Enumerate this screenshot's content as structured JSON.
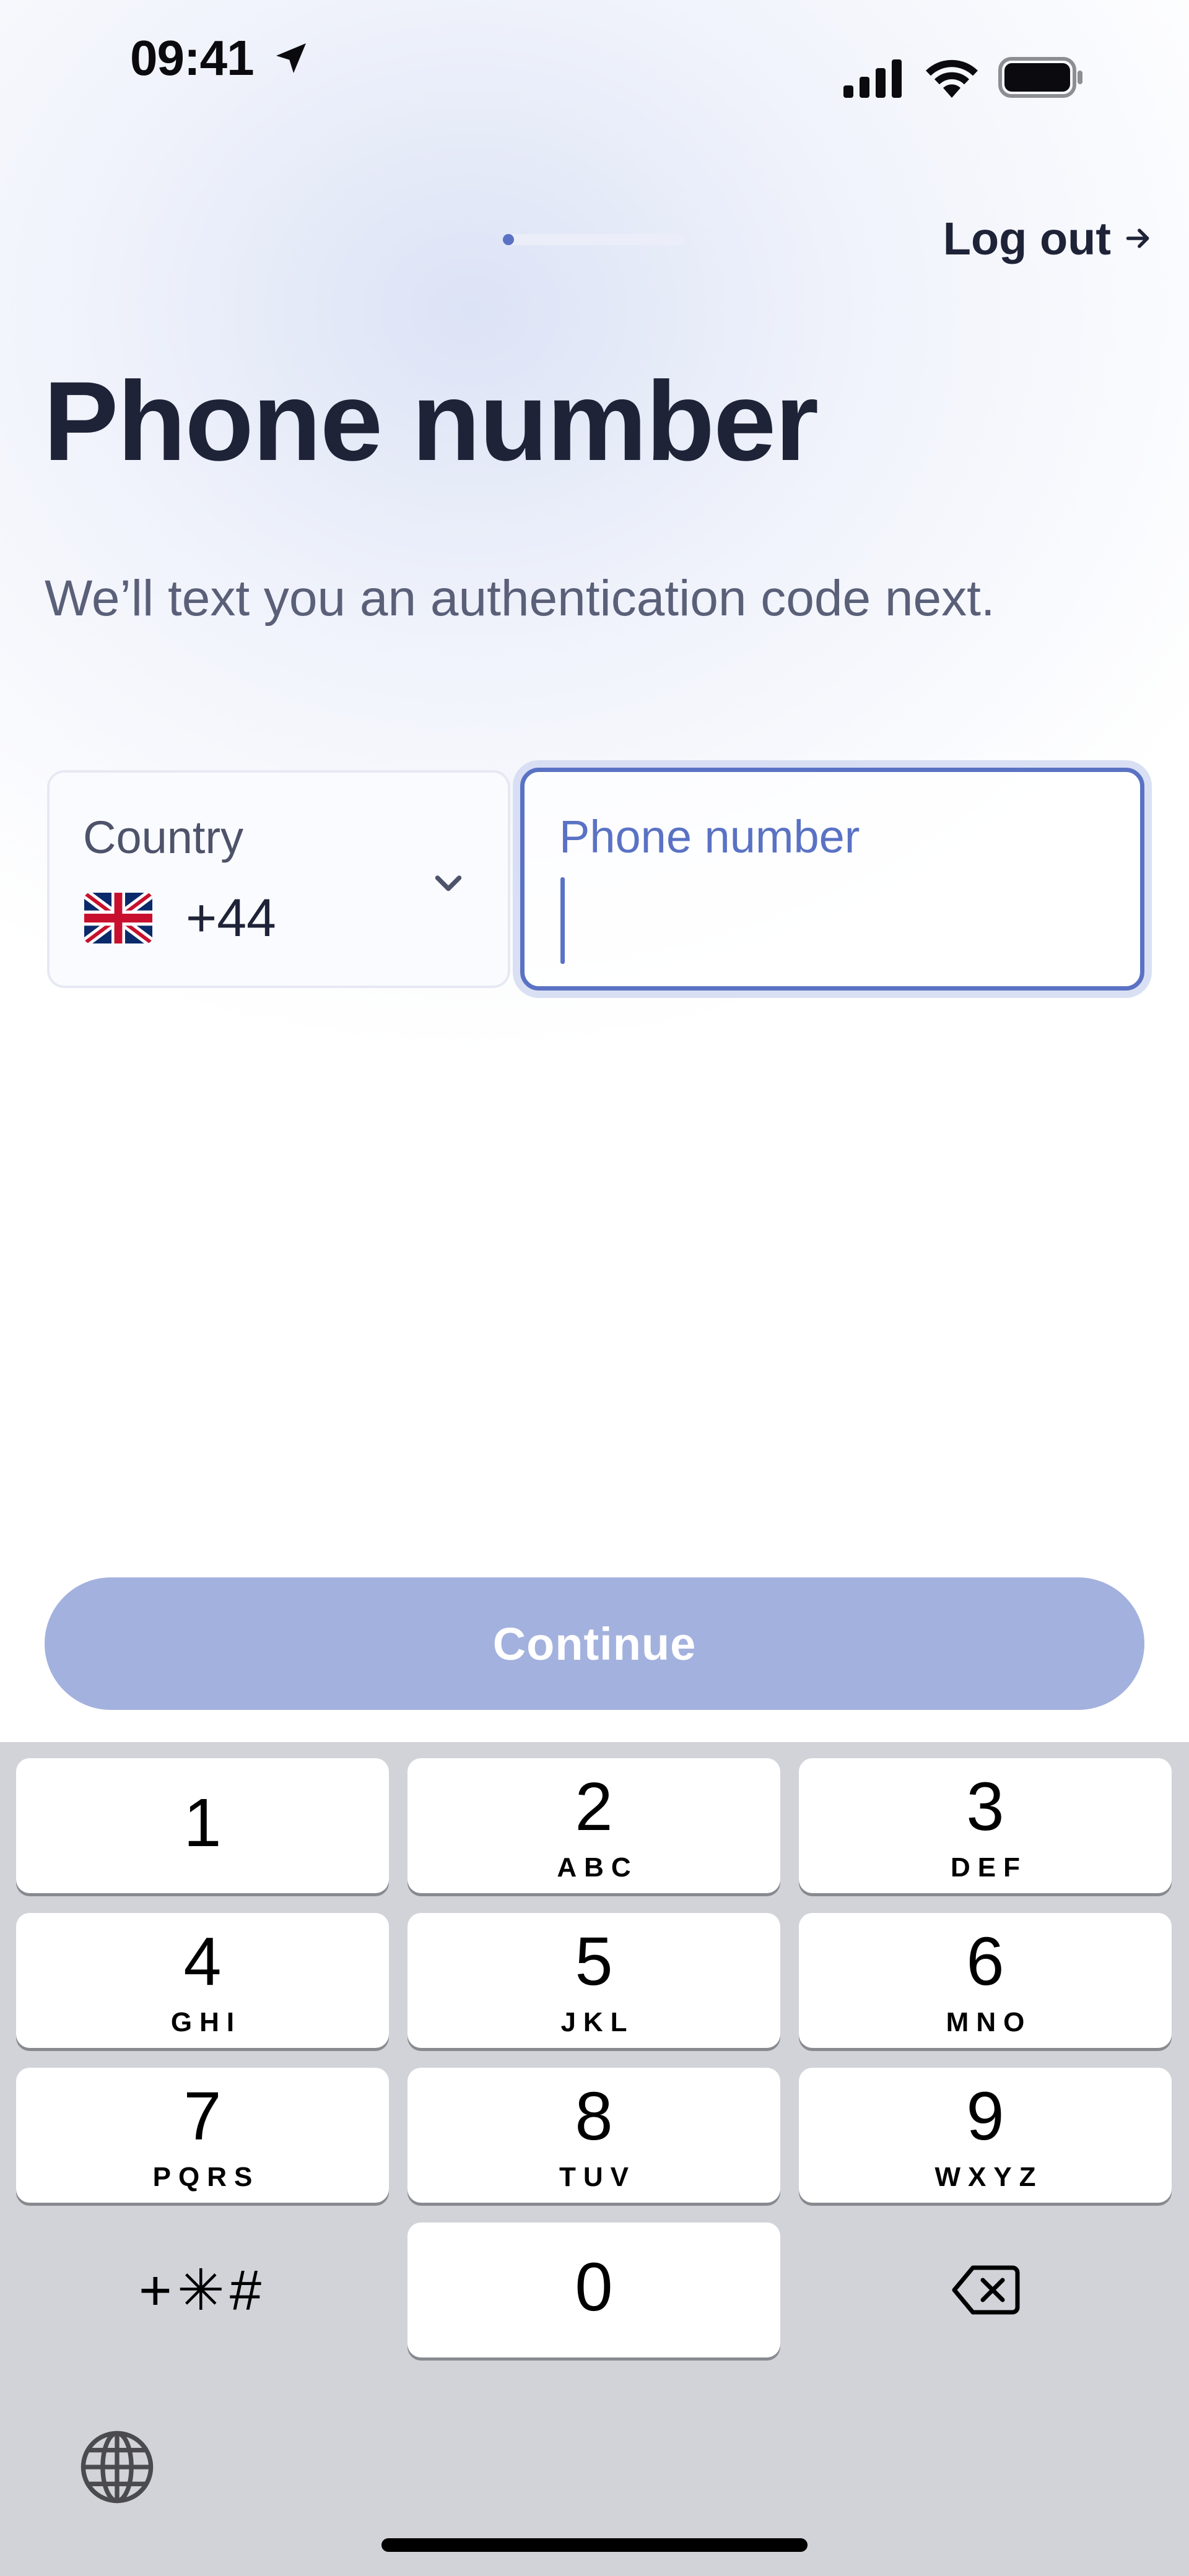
{
  "status_bar": {
    "time": "09:41",
    "icons": [
      "location-arrow-icon",
      "cellular-signal-icon",
      "wifi-icon",
      "battery-icon"
    ]
  },
  "header": {
    "progress": {
      "current_step": 1,
      "fraction": 0.06
    },
    "logout_label": "Log out",
    "logout_icon": "arrow-right-icon"
  },
  "main": {
    "title": "Phone number",
    "subtitle": "We’ll text you an authentication code next."
  },
  "form": {
    "country": {
      "label": "Country",
      "flag_icon": "uk-flag-icon",
      "dial_code": "+44",
      "dropdown_icon": "chevron-down-icon"
    },
    "phone": {
      "label": "Phone number",
      "value": ""
    },
    "continue_label": "Continue"
  },
  "keyboard": {
    "keys": [
      {
        "digit": "1",
        "letters": ""
      },
      {
        "digit": "2",
        "letters": "ABC"
      },
      {
        "digit": "3",
        "letters": "DEF"
      },
      {
        "digit": "4",
        "letters": "GHI"
      },
      {
        "digit": "5",
        "letters": "JKL"
      },
      {
        "digit": "6",
        "letters": "MNO"
      },
      {
        "digit": "7",
        "letters": "PQRS"
      },
      {
        "digit": "8",
        "letters": "TUV"
      },
      {
        "digit": "9",
        "letters": "WXYZ"
      },
      {
        "digit": "0",
        "letters": ""
      }
    ],
    "symbols_label": "+✳#",
    "delete_icon": "backspace-icon",
    "globe_icon": "globe-icon"
  },
  "colors": {
    "accent": "#5a72c4",
    "accent_disabled": "#a3b1de",
    "title_text": "#1e2338",
    "keyboard_bg": "#d1d3d9"
  }
}
